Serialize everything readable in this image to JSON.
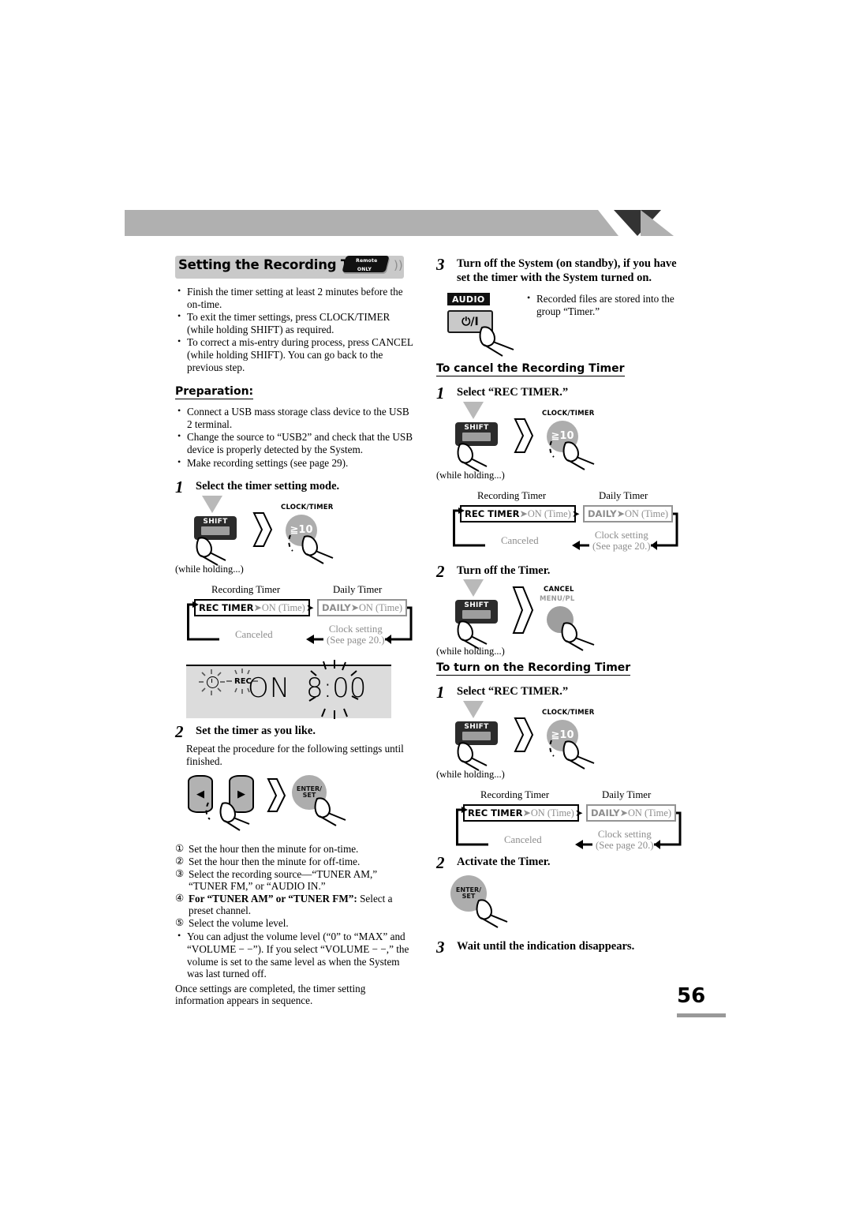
{
  "page_number": "56",
  "section": {
    "title": "Setting the Recording Timer",
    "remote_badge_line1": "Remote",
    "remote_badge_line2": "ONLY",
    "wave_icon": "signal-wave-icon"
  },
  "left": {
    "intro_bullets": [
      "Finish the timer setting at least 2 minutes before the on-time.",
      "To exit the timer settings, press CLOCK/TIMER (while holding SHIFT) as required.",
      "To correct a mis-entry during process, press CANCEL (while holding SHIFT). You can go back to the previous step."
    ],
    "preparation_heading": "Preparation:",
    "preparation_bullets": [
      "Connect a USB mass storage class device to the USB 2 terminal.",
      "Change the source to “USB2” and check that the USB device is properly detected by the System.",
      "Make recording settings (see page 29)."
    ],
    "step1": {
      "num": "1",
      "text": "Select the timer setting mode.",
      "diagram": {
        "shift_label": "SHIFT",
        "clock_timer_caption": "CLOCK/TIMER",
        "clock_timer_key": "≧10",
        "while_holding": "(while holding...)"
      },
      "flow": {
        "rec_head": "Recording Timer",
        "daily_head": "Daily Timer",
        "rec_box_bold": "REC TIMER",
        "rec_box_rest": "ON (Time)",
        "daily_box_bold": "DAILY",
        "daily_box_rest": "ON (Time)",
        "canceled": "Canceled",
        "clock_setting_l1": "Clock setting",
        "clock_setting_l2": "(See page 20.)"
      }
    },
    "lcd": {
      "clock_icon": "clock-icon",
      "rec_indicator": "REC",
      "on_text": "ON",
      "time_text": "8:00"
    },
    "step2": {
      "num": "2",
      "text": "Set the timer as you like.",
      "repeat_note": "Repeat the procedure for the following settings until finished.",
      "diagram": {
        "left_arrow": "◀",
        "right_arrow": "▶",
        "enter_l1": "ENTER/",
        "enter_l2": "SET"
      },
      "numbered": [
        {
          "n": "①",
          "text": "Set the hour then the minute for on-time."
        },
        {
          "n": "②",
          "text": "Set the hour then the minute for off-time."
        },
        {
          "n": "③",
          "text": "Select the recording source—“TUNER AM,” “TUNER FM,” or “AUDIO IN.”"
        },
        {
          "n": "④",
          "bold": "For “TUNER AM” or “TUNER FM”:",
          "text": " Select a preset channel."
        },
        {
          "n": "⑤",
          "text": "Select the volume level."
        }
      ],
      "volume_bullet": "You can adjust the volume level (“0” to “MAX” and “VOLUME − −”). If you select “VOLUME − −,” the volume is set to the same level as when the System was last turned off.",
      "closing_note": "Once settings are completed, the timer setting information appears in sequence."
    }
  },
  "right": {
    "step3": {
      "num": "3",
      "text": "Turn off the System (on standby), if you have set the timer with the System turned on.",
      "audio_label": "AUDIO",
      "power_symbol": "⏻/I",
      "note": "Recorded files are stored into the group “Timer.”"
    },
    "cancel_heading": "To cancel the Recording Timer",
    "cancel_step1": {
      "num": "1",
      "text": "Select “REC TIMER.”",
      "diagram": {
        "shift_label": "SHIFT",
        "clock_timer_caption": "CLOCK/TIMER",
        "clock_timer_key": "≧10",
        "while_holding": "(while holding...)"
      },
      "flow": {
        "rec_head": "Recording Timer",
        "daily_head": "Daily Timer",
        "rec_box_bold": "REC TIMER",
        "rec_box_rest": "ON (Time)",
        "daily_box_bold": "DAILY",
        "daily_box_rest": "ON (Time)",
        "canceled": "Canceled",
        "clock_setting_l1": "Clock setting",
        "clock_setting_l2": "(See page 20.)"
      }
    },
    "cancel_step2": {
      "num": "2",
      "text": "Turn off the Timer.",
      "diagram": {
        "shift_label": "SHIFT",
        "cancel_caption": "CANCEL",
        "menu_caption": "MENU/PL",
        "while_holding": "(while holding...)"
      }
    },
    "turnon_heading": "To turn on the Recording Timer",
    "turnon_step1": {
      "num": "1",
      "text": "Select “REC TIMER.”",
      "diagram": {
        "shift_label": "SHIFT",
        "clock_timer_caption": "CLOCK/TIMER",
        "clock_timer_key": "≧10",
        "while_holding": "(while holding...)"
      },
      "flow": {
        "rec_head": "Recording Timer",
        "daily_head": "Daily Timer",
        "rec_box_bold": "REC TIMER",
        "rec_box_rest": "ON (Time)",
        "daily_box_bold": "DAILY",
        "daily_box_rest": "ON (Time)",
        "canceled": "Canceled",
        "clock_setting_l1": "Clock setting",
        "clock_setting_l2": "(See page 20.)"
      }
    },
    "turnon_step2": {
      "num": "2",
      "text": "Activate the Timer.",
      "enter_l1": "ENTER/",
      "enter_l2": "SET"
    },
    "turnon_step3": {
      "num": "3",
      "text": "Wait until the indication disappears."
    }
  }
}
